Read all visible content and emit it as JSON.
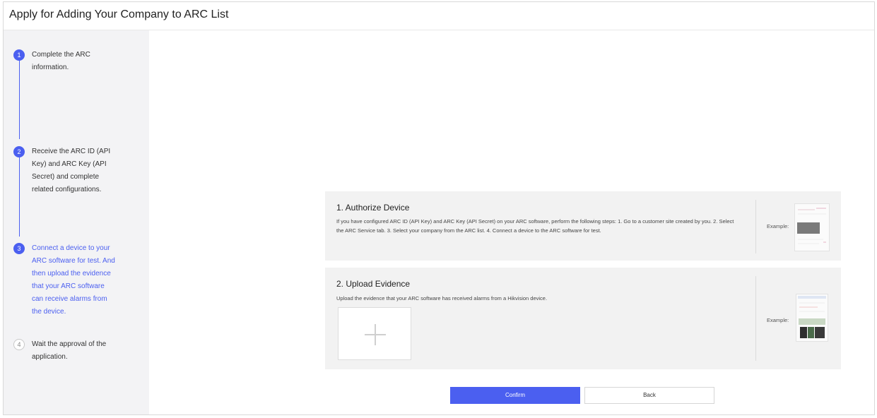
{
  "header": {
    "title": "Apply for Adding Your Company to ARC List"
  },
  "steps": [
    {
      "number": "1",
      "text": "Complete the ARC information.",
      "state": "done"
    },
    {
      "number": "2",
      "text": "Receive the ARC ID (API Key) and ARC Key (API Secret) and complete related configurations.",
      "state": "done"
    },
    {
      "number": "3",
      "text": "Connect a device to your ARC software for test. And then upload the evidence that your ARC software can receive alarms from the device.",
      "state": "active"
    },
    {
      "number": "4",
      "text": "Wait the approval of the application.",
      "state": "pending"
    }
  ],
  "authorize": {
    "title": "1. Authorize Device",
    "description": "If you have configured ARC ID (API Key) and ARC Key (API Secret) on your ARC software, perform the following steps: 1. Go to a customer site created by you. 2. Select the ARC Service tab. 3. Select your company from the ARC list. 4. Connect a device to the ARC software for test.",
    "example_label": "Example:"
  },
  "upload": {
    "title": "2. Upload Evidence",
    "description": "Upload the evidence that your ARC software has received alarms from a Hikvision device.",
    "example_label": "Example:"
  },
  "buttons": {
    "confirm": "Confirm",
    "back": "Back"
  },
  "colors": {
    "accent": "#4b5ff0",
    "sidebar": "#f3f3f5",
    "card": "#f2f2f2"
  }
}
